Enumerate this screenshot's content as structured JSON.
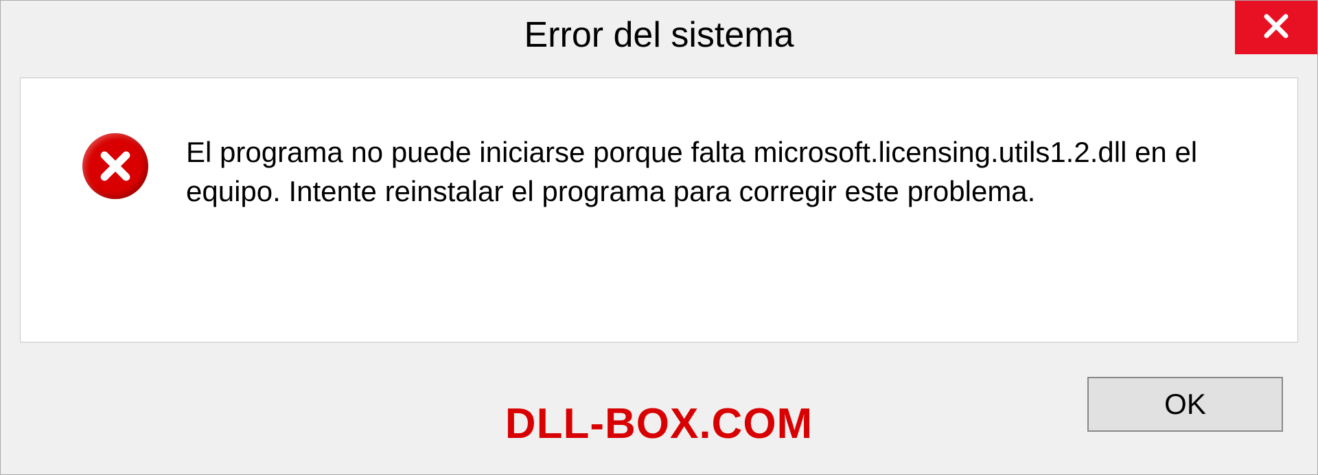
{
  "dialog": {
    "title": "Error del sistema",
    "message": "El programa no puede iniciarse porque falta microsoft.licensing.utils1.2.dll en el equipo. Intente reinstalar el programa para corregir este problema.",
    "ok_label": "OK"
  },
  "watermark": "DLL-BOX.COM",
  "colors": {
    "error_red": "#d80000",
    "close_red": "#e81123"
  }
}
